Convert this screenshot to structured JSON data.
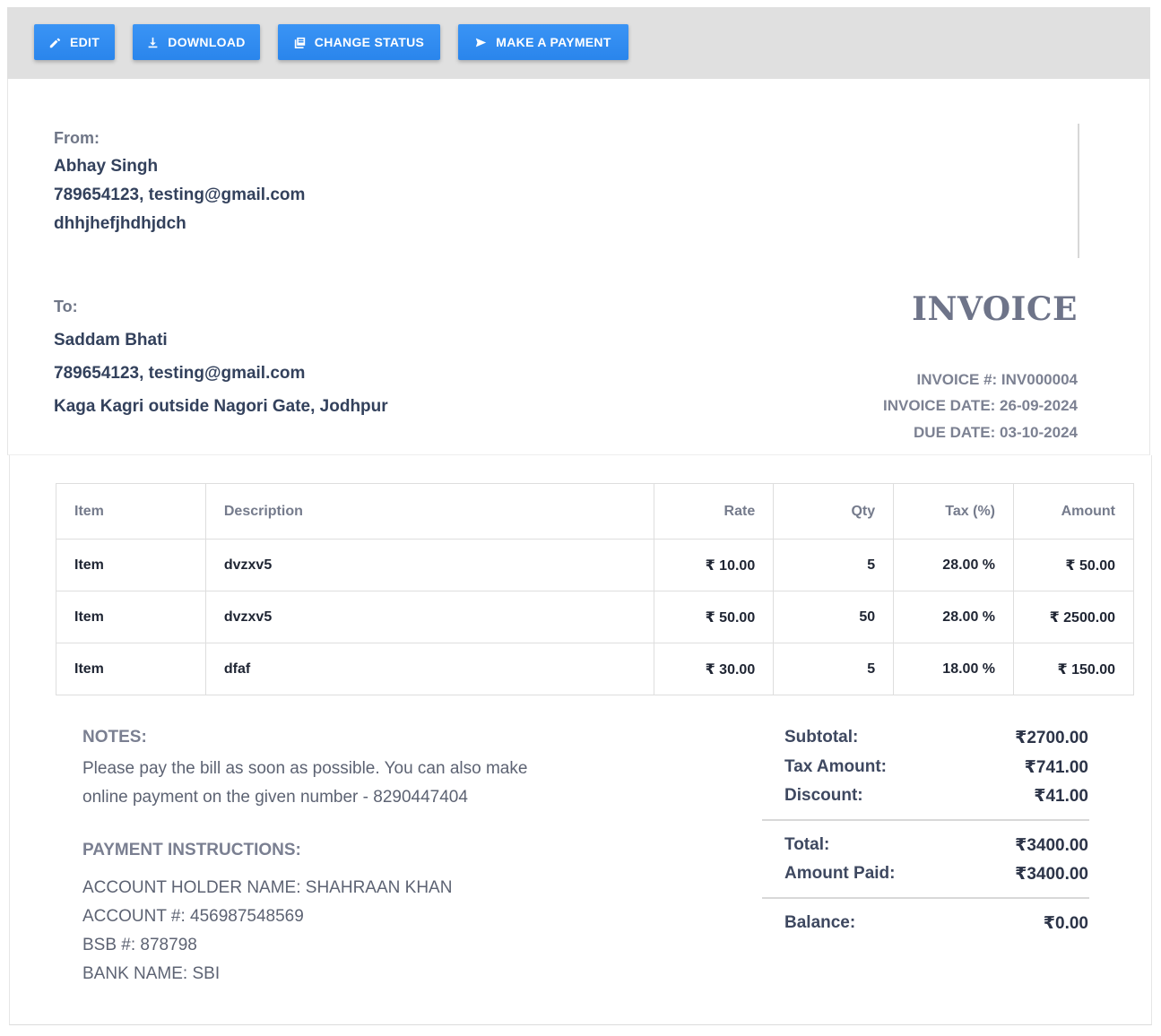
{
  "toolbar": {
    "buttons": {
      "edit": {
        "label": "EDIT",
        "icon": "pencil-icon"
      },
      "download": {
        "label": "DOWNLOAD",
        "icon": "download-icon"
      },
      "change_status": {
        "label": "CHANGE STATUS",
        "icon": "status-icon"
      },
      "make_payment": {
        "label": "MAKE A PAYMENT",
        "icon": "send-icon"
      }
    }
  },
  "invoice": {
    "from": {
      "label": "From:",
      "name": "Abhay Singh",
      "contact": "789654123, testing@gmail.com",
      "address": "dhhjhefjhdhjdch"
    },
    "to": {
      "label": "To:",
      "name": "Saddam Bhati",
      "contact": "789654123, testing@gmail.com",
      "address": "Kaga Kagri outside Nagori Gate, Jodhpur"
    },
    "title": "INVOICE",
    "meta": {
      "number": "INVOICE #: INV000004",
      "date": "INVOICE DATE: 26-09-2024",
      "due_date": "DUE DATE: 03-10-2024"
    }
  },
  "table": {
    "headers": {
      "item": "Item",
      "description": "Description",
      "rate": "Rate",
      "qty": "Qty",
      "tax": "Tax (%)",
      "amount": "Amount"
    },
    "rows": [
      {
        "item": "Item",
        "description": "dvzxv5",
        "rate": "₹ 10.00",
        "qty": "5",
        "tax": "28.00 %",
        "amount": "₹ 50.00"
      },
      {
        "item": "Item",
        "description": "dvzxv5",
        "rate": "₹ 50.00",
        "qty": "50",
        "tax": "28.00 %",
        "amount": "₹ 2500.00"
      },
      {
        "item": "Item",
        "description": "dfaf",
        "rate": "₹ 30.00",
        "qty": "5",
        "tax": "18.00 %",
        "amount": "₹ 150.00"
      }
    ]
  },
  "notes": {
    "title": "NOTES:",
    "text": "Please pay the bill as soon as possible. You can also make online payment on the given number - 8290447404"
  },
  "payment_instructions": {
    "title": "PAYMENT INSTRUCTIONS:",
    "lines": [
      "ACCOUNT HOLDER NAME: SHAHRAAN KHAN",
      "ACCOUNT #: 456987548569",
      "BSB #: 878798",
      "BANK NAME: SBI"
    ]
  },
  "summary": {
    "subtotal": {
      "label": "Subtotal:",
      "value": "₹2700.00"
    },
    "tax_amount": {
      "label": "Tax Amount:",
      "value": "₹741.00"
    },
    "discount": {
      "label": "Discount:",
      "value": "₹41.00"
    },
    "total": {
      "label": "Total:",
      "value": "₹3400.00"
    },
    "amount_paid": {
      "label": "Amount Paid:",
      "value": "₹3400.00"
    },
    "balance": {
      "label": "Balance:",
      "value": "₹0.00"
    }
  }
}
